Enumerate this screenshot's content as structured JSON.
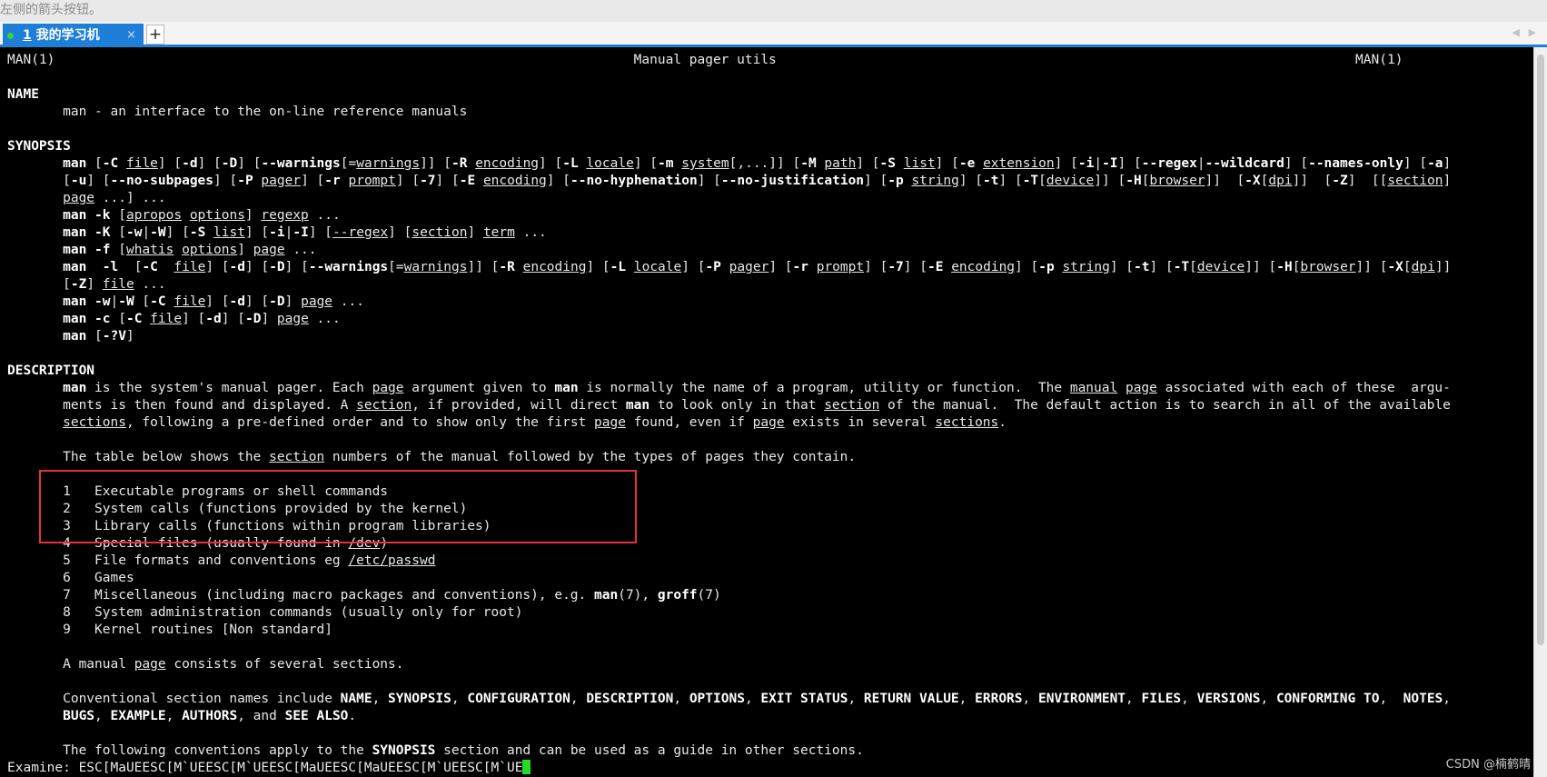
{
  "hint_bar": {
    "text": "左侧的箭头按钮。"
  },
  "tabs": [
    {
      "number": "1",
      "title": "我的学习机",
      "close": "×",
      "active": true
    }
  ],
  "new_tab_label": "+",
  "terminal": {
    "lines": [
      [
        [
          "t",
          "MAN(1)                                                                         Manual pager utils                                                                         MAN(1)"
        ]
      ],
      [],
      [
        [
          "b",
          "NAME"
        ]
      ],
      [
        [
          "t",
          "       man - an interface to the on-line reference manuals"
        ]
      ],
      [],
      [
        [
          "b",
          "SYNOPSIS"
        ]
      ],
      [
        [
          "t",
          "       "
        ],
        [
          "b",
          "man"
        ],
        [
          "t",
          " ["
        ],
        [
          "b",
          "-C"
        ],
        [
          "t",
          " "
        ],
        [
          "u",
          "file"
        ],
        [
          "t",
          "] ["
        ],
        [
          "b",
          "-d"
        ],
        [
          "t",
          "] ["
        ],
        [
          "b",
          "-D"
        ],
        [
          "t",
          "] ["
        ],
        [
          "b",
          "--warnings"
        ],
        [
          "t",
          "[="
        ],
        [
          "u",
          "warnings"
        ],
        [
          "t",
          "]] ["
        ],
        [
          "b",
          "-R"
        ],
        [
          "t",
          " "
        ],
        [
          "u",
          "encoding"
        ],
        [
          "t",
          "] ["
        ],
        [
          "b",
          "-L"
        ],
        [
          "t",
          " "
        ],
        [
          "u",
          "locale"
        ],
        [
          "t",
          "] ["
        ],
        [
          "b",
          "-m"
        ],
        [
          "t",
          " "
        ],
        [
          "u",
          "system"
        ],
        [
          "t",
          "[,...]] ["
        ],
        [
          "b",
          "-M"
        ],
        [
          "t",
          " "
        ],
        [
          "u",
          "path"
        ],
        [
          "t",
          "] ["
        ],
        [
          "b",
          "-S"
        ],
        [
          "t",
          " "
        ],
        [
          "u",
          "list"
        ],
        [
          "t",
          "] ["
        ],
        [
          "b",
          "-e"
        ],
        [
          "t",
          " "
        ],
        [
          "u",
          "extension"
        ],
        [
          "t",
          "] ["
        ],
        [
          "b",
          "-i"
        ],
        [
          "t",
          "|"
        ],
        [
          "b",
          "-I"
        ],
        [
          "t",
          "] ["
        ],
        [
          "b",
          "--regex"
        ],
        [
          "t",
          "|"
        ],
        [
          "b",
          "--wildcard"
        ],
        [
          "t",
          "] ["
        ],
        [
          "b",
          "--names-only"
        ],
        [
          "t",
          "] ["
        ],
        [
          "b",
          "-a"
        ],
        [
          "t",
          "]"
        ]
      ],
      [
        [
          "t",
          "       ["
        ],
        [
          "b",
          "-u"
        ],
        [
          "t",
          "] ["
        ],
        [
          "b",
          "--no-subpages"
        ],
        [
          "t",
          "] ["
        ],
        [
          "b",
          "-P"
        ],
        [
          "t",
          " "
        ],
        [
          "u",
          "pager"
        ],
        [
          "t",
          "] ["
        ],
        [
          "b",
          "-r"
        ],
        [
          "t",
          " "
        ],
        [
          "u",
          "prompt"
        ],
        [
          "t",
          "] ["
        ],
        [
          "b",
          "-7"
        ],
        [
          "t",
          "] ["
        ],
        [
          "b",
          "-E"
        ],
        [
          "t",
          " "
        ],
        [
          "u",
          "encoding"
        ],
        [
          "t",
          "] ["
        ],
        [
          "b",
          "--no-hyphenation"
        ],
        [
          "t",
          "] ["
        ],
        [
          "b",
          "--no-justification"
        ],
        [
          "t",
          "] ["
        ],
        [
          "b",
          "-p"
        ],
        [
          "t",
          " "
        ],
        [
          "u",
          "string"
        ],
        [
          "t",
          "] ["
        ],
        [
          "b",
          "-t"
        ],
        [
          "t",
          "] ["
        ],
        [
          "b",
          "-T"
        ],
        [
          "t",
          "["
        ],
        [
          "u",
          "device"
        ],
        [
          "t",
          "]] ["
        ],
        [
          "b",
          "-H"
        ],
        [
          "t",
          "["
        ],
        [
          "u",
          "browser"
        ],
        [
          "t",
          "]]  ["
        ],
        [
          "b",
          "-X"
        ],
        [
          "t",
          "["
        ],
        [
          "u",
          "dpi"
        ],
        [
          "t",
          "]]  ["
        ],
        [
          "b",
          "-Z"
        ],
        [
          "t",
          "]  [["
        ],
        [
          "u",
          "section"
        ],
        [
          "t",
          "]"
        ]
      ],
      [
        [
          "t",
          "       "
        ],
        [
          "u",
          "page"
        ],
        [
          "t",
          " ...] ..."
        ]
      ],
      [
        [
          "t",
          "       "
        ],
        [
          "b",
          "man -k"
        ],
        [
          "t",
          " ["
        ],
        [
          "u",
          "apropos"
        ],
        [
          "t",
          " "
        ],
        [
          "u",
          "options"
        ],
        [
          "t",
          "] "
        ],
        [
          "u",
          "regexp"
        ],
        [
          "t",
          " ..."
        ]
      ],
      [
        [
          "t",
          "       "
        ],
        [
          "b",
          "man -K"
        ],
        [
          "t",
          " ["
        ],
        [
          "b",
          "-w"
        ],
        [
          "t",
          "|"
        ],
        [
          "b",
          "-W"
        ],
        [
          "t",
          "] ["
        ],
        [
          "b",
          "-S"
        ],
        [
          "t",
          " "
        ],
        [
          "u",
          "list"
        ],
        [
          "t",
          "] ["
        ],
        [
          "b",
          "-i"
        ],
        [
          "t",
          "|"
        ],
        [
          "b",
          "-I"
        ],
        [
          "t",
          "] ["
        ],
        [
          "u",
          "--regex"
        ],
        [
          "t",
          "] ["
        ],
        [
          "u",
          "section"
        ],
        [
          "t",
          "] "
        ],
        [
          "u",
          "term"
        ],
        [
          "t",
          " ..."
        ]
      ],
      [
        [
          "t",
          "       "
        ],
        [
          "b",
          "man -f"
        ],
        [
          "t",
          " ["
        ],
        [
          "u",
          "whatis"
        ],
        [
          "t",
          " "
        ],
        [
          "u",
          "options"
        ],
        [
          "t",
          "] "
        ],
        [
          "u",
          "page"
        ],
        [
          "t",
          " ..."
        ]
      ],
      [
        [
          "t",
          "       "
        ],
        [
          "b",
          "man"
        ],
        [
          "t",
          "  "
        ],
        [
          "b",
          "-l"
        ],
        [
          "t",
          "  ["
        ],
        [
          "b",
          "-C"
        ],
        [
          "t",
          "  "
        ],
        [
          "u",
          "file"
        ],
        [
          "t",
          "] ["
        ],
        [
          "b",
          "-d"
        ],
        [
          "t",
          "] ["
        ],
        [
          "b",
          "-D"
        ],
        [
          "t",
          "] ["
        ],
        [
          "b",
          "--warnings"
        ],
        [
          "t",
          "[="
        ],
        [
          "u",
          "warnings"
        ],
        [
          "t",
          "]] ["
        ],
        [
          "b",
          "-R"
        ],
        [
          "t",
          " "
        ],
        [
          "u",
          "encoding"
        ],
        [
          "t",
          "] ["
        ],
        [
          "b",
          "-L"
        ],
        [
          "t",
          " "
        ],
        [
          "u",
          "locale"
        ],
        [
          "t",
          "] ["
        ],
        [
          "b",
          "-P"
        ],
        [
          "t",
          " "
        ],
        [
          "u",
          "pager"
        ],
        [
          "t",
          "] ["
        ],
        [
          "b",
          "-r"
        ],
        [
          "t",
          " "
        ],
        [
          "u",
          "prompt"
        ],
        [
          "t",
          "] ["
        ],
        [
          "b",
          "-7"
        ],
        [
          "t",
          "] ["
        ],
        [
          "b",
          "-E"
        ],
        [
          "t",
          " "
        ],
        [
          "u",
          "encoding"
        ],
        [
          "t",
          "] ["
        ],
        [
          "b",
          "-p"
        ],
        [
          "t",
          " "
        ],
        [
          "u",
          "string"
        ],
        [
          "t",
          "] ["
        ],
        [
          "b",
          "-t"
        ],
        [
          "t",
          "] ["
        ],
        [
          "b",
          "-T"
        ],
        [
          "t",
          "["
        ],
        [
          "u",
          "device"
        ],
        [
          "t",
          "]] ["
        ],
        [
          "b",
          "-H"
        ],
        [
          "t",
          "["
        ],
        [
          "u",
          "browser"
        ],
        [
          "t",
          "]] ["
        ],
        [
          "b",
          "-X"
        ],
        [
          "t",
          "["
        ],
        [
          "u",
          "dpi"
        ],
        [
          "t",
          "]]"
        ]
      ],
      [
        [
          "t",
          "       ["
        ],
        [
          "b",
          "-Z"
        ],
        [
          "t",
          "] "
        ],
        [
          "u",
          "file"
        ],
        [
          "t",
          " ..."
        ]
      ],
      [
        [
          "t",
          "       "
        ],
        [
          "b",
          "man -w"
        ],
        [
          "t",
          "|"
        ],
        [
          "b",
          "-W"
        ],
        [
          "t",
          " ["
        ],
        [
          "b",
          "-C"
        ],
        [
          "t",
          " "
        ],
        [
          "u",
          "file"
        ],
        [
          "t",
          "] ["
        ],
        [
          "b",
          "-d"
        ],
        [
          "t",
          "] ["
        ],
        [
          "b",
          "-D"
        ],
        [
          "t",
          "] "
        ],
        [
          "u",
          "page"
        ],
        [
          "t",
          " ..."
        ]
      ],
      [
        [
          "t",
          "       "
        ],
        [
          "b",
          "man -c"
        ],
        [
          "t",
          " ["
        ],
        [
          "b",
          "-C"
        ],
        [
          "t",
          " "
        ],
        [
          "u",
          "file"
        ],
        [
          "t",
          "] ["
        ],
        [
          "b",
          "-d"
        ],
        [
          "t",
          "] ["
        ],
        [
          "b",
          "-D"
        ],
        [
          "t",
          "] "
        ],
        [
          "u",
          "page"
        ],
        [
          "t",
          " ..."
        ]
      ],
      [
        [
          "t",
          "       "
        ],
        [
          "b",
          "man"
        ],
        [
          "t",
          " ["
        ],
        [
          "b",
          "-?V"
        ],
        [
          "t",
          "]"
        ]
      ],
      [],
      [
        [
          "b",
          "DESCRIPTION"
        ]
      ],
      [
        [
          "t",
          "       "
        ],
        [
          "b",
          "man"
        ],
        [
          "t",
          " is the system's manual pager. Each "
        ],
        [
          "u",
          "page"
        ],
        [
          "t",
          " argument given to "
        ],
        [
          "b",
          "man"
        ],
        [
          "t",
          " is normally the name of a program, utility or function.  The "
        ],
        [
          "u",
          "manual"
        ],
        [
          "t",
          " "
        ],
        [
          "u",
          "page"
        ],
        [
          "t",
          " associated with each of these  argu-"
        ]
      ],
      [
        [
          "t",
          "       ments is then found and displayed. A "
        ],
        [
          "u",
          "section"
        ],
        [
          "t",
          ", if provided, will direct "
        ],
        [
          "b",
          "man"
        ],
        [
          "t",
          " to look only in that "
        ],
        [
          "u",
          "section"
        ],
        [
          "t",
          " of the manual.  The default action is to search in all of the available"
        ]
      ],
      [
        [
          "t",
          "       "
        ],
        [
          "u",
          "sections"
        ],
        [
          "t",
          ", following a pre-defined order and to show only the first "
        ],
        [
          "u",
          "page"
        ],
        [
          "t",
          " found, even if "
        ],
        [
          "u",
          "page"
        ],
        [
          "t",
          " exists in several "
        ],
        [
          "u",
          "sections"
        ],
        [
          "t",
          "."
        ]
      ],
      [],
      [
        [
          "t",
          "       The table below shows the "
        ],
        [
          "u",
          "section"
        ],
        [
          "t",
          " numbers of the manual followed by the types of pages they contain."
        ]
      ],
      [],
      [
        [
          "t",
          "       1   Executable programs or shell commands"
        ]
      ],
      [
        [
          "t",
          "       2   System calls (functions provided by the kernel)"
        ]
      ],
      [
        [
          "t",
          "       3   Library calls (functions within program libraries)"
        ]
      ],
      [
        [
          "t",
          "       4   Special files (usually found in "
        ],
        [
          "u",
          "/dev"
        ],
        [
          "t",
          ")"
        ]
      ],
      [
        [
          "t",
          "       5   File formats and conventions eg "
        ],
        [
          "u",
          "/etc/passwd"
        ]
      ],
      [
        [
          "t",
          "       6   Games"
        ]
      ],
      [
        [
          "t",
          "       7   Miscellaneous (including macro packages and conventions), e.g. "
        ],
        [
          "b",
          "man"
        ],
        [
          "t",
          "(7), "
        ],
        [
          "b",
          "groff"
        ],
        [
          "t",
          "(7)"
        ]
      ],
      [
        [
          "t",
          "       8   System administration commands (usually only for root)"
        ]
      ],
      [
        [
          "t",
          "       9   Kernel routines [Non standard]"
        ]
      ],
      [],
      [
        [
          "t",
          "       A manual "
        ],
        [
          "u",
          "page"
        ],
        [
          "t",
          " consists of several sections."
        ]
      ],
      [],
      [
        [
          "t",
          "       Conventional section names include "
        ],
        [
          "b",
          "NAME"
        ],
        [
          "t",
          ", "
        ],
        [
          "b",
          "SYNOPSIS"
        ],
        [
          "t",
          ", "
        ],
        [
          "b",
          "CONFIGURATION"
        ],
        [
          "t",
          ", "
        ],
        [
          "b",
          "DESCRIPTION"
        ],
        [
          "t",
          ", "
        ],
        [
          "b",
          "OPTIONS"
        ],
        [
          "t",
          ", "
        ],
        [
          "b",
          "EXIT STATUS"
        ],
        [
          "t",
          ", "
        ],
        [
          "b",
          "RETURN VALUE"
        ],
        [
          "t",
          ", "
        ],
        [
          "b",
          "ERRORS"
        ],
        [
          "t",
          ", "
        ],
        [
          "b",
          "ENVIRONMENT"
        ],
        [
          "t",
          ", "
        ],
        [
          "b",
          "FILES"
        ],
        [
          "t",
          ", "
        ],
        [
          "b",
          "VERSIONS"
        ],
        [
          "t",
          ", "
        ],
        [
          "b",
          "CONFORMING TO"
        ],
        [
          "t",
          ",  "
        ],
        [
          "b",
          "NOTES"
        ],
        [
          "t",
          ","
        ]
      ],
      [
        [
          "t",
          "       "
        ],
        [
          "b",
          "BUGS"
        ],
        [
          "t",
          ", "
        ],
        [
          "b",
          "EXAMPLE"
        ],
        [
          "t",
          ", "
        ],
        [
          "b",
          "AUTHORS"
        ],
        [
          "t",
          ", and "
        ],
        [
          "b",
          "SEE ALSO"
        ],
        [
          "t",
          "."
        ]
      ],
      [],
      [
        [
          "t",
          "       The following conventions apply to the "
        ],
        [
          "b",
          "SYNOPSIS"
        ],
        [
          "t",
          " section and can be used as a guide in other sections."
        ]
      ],
      [
        [
          "t",
          "Examine: ESC[MaUEESC[M`UEESC[M`UEESC[MaUEESC[MaUEESC[M`UEESC[M`UE"
        ],
        [
          "c",
          ""
        ]
      ]
    ]
  },
  "watermark": "CSDN @楠鹤晴",
  "colors": {
    "terminal_bg": "#000000",
    "text": "#e8e8e8",
    "tab_active": "#1e7fd8",
    "highlight": "#e8323b",
    "cursor": "#22dd22"
  }
}
